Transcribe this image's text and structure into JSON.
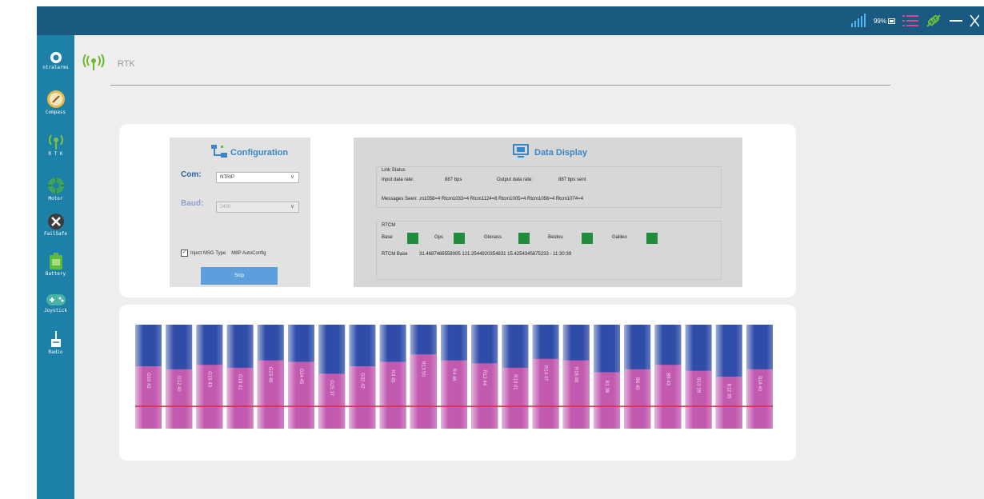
{
  "status_bar": {
    "battery_text": "99%"
  },
  "sidebar": {
    "items": [
      {
        "label": "ntralarms",
        "icon": "alarm-icon"
      },
      {
        "label": "Compass",
        "icon": "compass-icon"
      },
      {
        "label": "R T K",
        "icon": "rtk-antenna-icon"
      },
      {
        "label": "Motor",
        "icon": "motor-icon"
      },
      {
        "label": "FailSafe",
        "icon": "failsafe-icon"
      },
      {
        "label": "Battery",
        "icon": "battery-icon"
      },
      {
        "label": "Joystick",
        "icon": "joystick-icon"
      },
      {
        "label": "Radio",
        "icon": "radio-icon"
      }
    ]
  },
  "header": {
    "title": "RTK"
  },
  "config": {
    "title": "Configuration",
    "com_label": "Com:",
    "com_value": "NTRIP",
    "baud_label": "Baud:",
    "baud_value": "2400",
    "inject_label": "Inject MSG Type",
    "autoconfig_label": "M8P AutoConfig",
    "stop_label": "Stop"
  },
  "data_display": {
    "title": "Data Display",
    "link_status_label": "Link Status",
    "input_rate_label": "Input data rate:",
    "input_rate_value": "887 bps",
    "output_rate_label": "Output data rate:",
    "output_rate_value": "887 bps sent",
    "messages_seen": "Messages Seen: ,m1058=4 Rtcm1033=4 Rtcm1124=8 Rtcm1005=4 Rtcm1056=4 Rtcm1074=4",
    "rtcm_label": "RTCM",
    "constellations": [
      "Base",
      "Gps",
      "Glonass",
      "Beidou",
      "Galileo"
    ],
    "status_color": "#1f8d3c",
    "rtcm_base_label": "RTCM Base",
    "rtcm_base_value": "31.4687486558005 121.2544920354831 15.4254345875233 - 11:30:39"
  },
  "chart_data": {
    "type": "bar",
    "categories": [
      "G10",
      "G12",
      "G15",
      "G18",
      "G23",
      "G24",
      "G29",
      "G32",
      "R3",
      "R13",
      "R4",
      "R12",
      "R13",
      "R14",
      "R18",
      "B1",
      "B6",
      "B9",
      "B6",
      "B12",
      "B14"
    ],
    "labels": [
      "G10 42",
      "G12 40",
      "G15 43",
      "G18 41",
      "G23 46",
      "G24 45",
      "G25 37",
      "G32 42",
      "R3 45",
      "R13 50",
      "R4 46",
      "R12 44",
      "R13 41",
      "R14 47",
      "R18 46",
      "B1 38",
      "B6 40",
      "B9 43",
      "B10 39",
      "B12 35",
      "B14 40"
    ],
    "values": [
      42,
      40,
      43,
      41,
      46,
      45,
      37,
      42,
      45,
      50,
      46,
      44,
      41,
      47,
      46,
      38,
      40,
      43,
      39,
      35,
      40
    ],
    "ylim": [
      0,
      70
    ],
    "threshold": 15,
    "colors": {
      "bar_fill": "#c25ab0",
      "bar_top": "#2f4da8",
      "threshold_line": "#e02a46"
    }
  }
}
